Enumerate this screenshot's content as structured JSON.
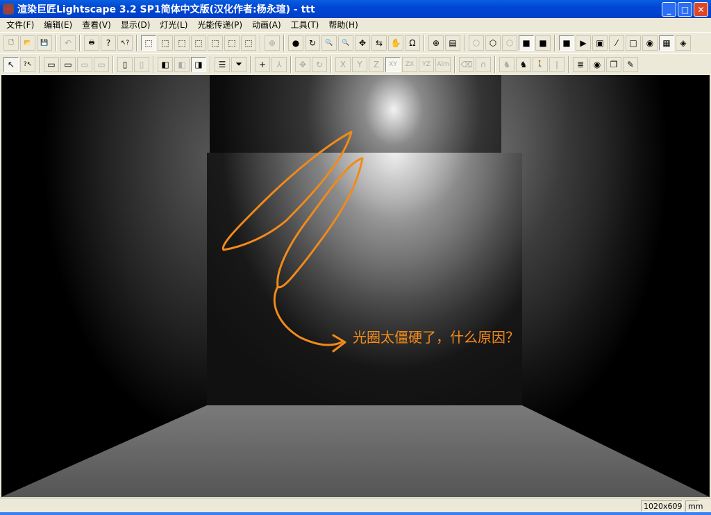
{
  "window": {
    "title": "渲染巨匠Lightscape 3.2 SP1简体中文版(汉化作者:杨永瑄) - ttt",
    "minimize": "_",
    "maximize": "□",
    "close": "✕"
  },
  "menu": [
    "文件(F)",
    "编辑(E)",
    "查看(V)",
    "显示(D)",
    "灯光(L)",
    "光能传递(P)",
    "动画(A)",
    "工具(T)",
    "帮助(H)"
  ],
  "toolbar1": [
    {
      "n": "new-file",
      "g": "🗋"
    },
    {
      "n": "open-folder",
      "g": "📂"
    },
    {
      "n": "save",
      "g": "💾"
    },
    "|",
    {
      "n": "undo",
      "g": "↶",
      "d": 1
    },
    "|",
    {
      "n": "print",
      "g": "🖶"
    },
    {
      "n": "help",
      "g": "?"
    },
    {
      "n": "context-help",
      "g": "↖?"
    },
    "|",
    {
      "n": "select-cube",
      "g": "⬚",
      "on": 1
    },
    {
      "n": "wireframe",
      "g": "⬚"
    },
    {
      "n": "shade-front",
      "g": "⬚"
    },
    {
      "n": "shade-top",
      "g": "⬚"
    },
    {
      "n": "shade-side",
      "g": "⬚"
    },
    {
      "n": "shade-back",
      "g": "⬚"
    },
    {
      "n": "shade-all",
      "g": "⬚"
    },
    "|",
    {
      "n": "zoom-extents",
      "g": "⊕",
      "d": 1
    },
    "|",
    {
      "n": "orbit",
      "g": "●"
    },
    {
      "n": "rotate-view",
      "g": "↻"
    },
    {
      "n": "zoom-in",
      "g": "🔍"
    },
    {
      "n": "zoom",
      "g": "🔍"
    },
    {
      "n": "pan",
      "g": "✥"
    },
    {
      "n": "dolly",
      "g": "⇆"
    },
    {
      "n": "walk",
      "g": "✋"
    },
    {
      "n": "roll",
      "g": "Ω"
    },
    "|",
    {
      "n": "zoom-window",
      "g": "⊕"
    },
    {
      "n": "camera-view",
      "g": "▤"
    },
    "|",
    {
      "n": "display-wire",
      "g": "⬡",
      "d": 1
    },
    {
      "n": "display-hidden",
      "g": "⬡"
    },
    {
      "n": "display-outline",
      "g": "⬡",
      "d": 1
    },
    {
      "n": "display-solid",
      "g": "■",
      "on": 1
    },
    {
      "n": "display-shaded",
      "g": "■"
    },
    "|",
    {
      "n": "texture",
      "g": "■",
      "on": 1
    },
    {
      "n": "mesh",
      "g": "▶"
    },
    {
      "n": "layers",
      "g": "▣"
    },
    {
      "n": "lines",
      "g": "⁄"
    },
    {
      "n": "light-color",
      "g": "□"
    },
    {
      "n": "globe",
      "g": "◉"
    },
    {
      "n": "background",
      "g": "▦",
      "on": 1
    },
    {
      "n": "render",
      "g": "◈"
    }
  ],
  "toolbar2": [
    {
      "n": "select",
      "g": "↖",
      "on": 1
    },
    {
      "n": "query",
      "g": "?↖"
    },
    "|",
    {
      "n": "select-window",
      "g": "▭"
    },
    {
      "n": "zoom-select",
      "g": "▭"
    },
    {
      "n": "deselect",
      "g": "▭",
      "d": 1
    },
    {
      "n": "deselect-window",
      "g": "▭",
      "d": 1
    },
    "|",
    {
      "n": "select-page",
      "g": "▯"
    },
    {
      "n": "page",
      "g": "▯",
      "d": 1
    },
    "|",
    {
      "n": "select-surface",
      "g": "◧"
    },
    {
      "n": "select-group",
      "g": "◧",
      "d": 1
    },
    {
      "n": "select-light",
      "g": "◨",
      "on": 1
    },
    "|",
    {
      "n": "list",
      "g": "☰"
    },
    {
      "n": "filter",
      "g": "⏷"
    },
    "|",
    {
      "n": "add-point",
      "g": "+"
    },
    {
      "n": "hierarchy",
      "g": "⅄",
      "d": 1
    },
    "|",
    {
      "n": "move",
      "g": "✥",
      "d": 1
    },
    {
      "n": "rotate",
      "g": "↻",
      "d": 1
    },
    "|",
    {
      "n": "axis-x",
      "g": "X",
      "d": 1
    },
    {
      "n": "axis-y",
      "g": "Y",
      "d": 1
    },
    {
      "n": "axis-z",
      "g": "Z",
      "d": 1
    },
    {
      "n": "plane-xy",
      "g": "XY",
      "d": 1,
      "on": 1
    },
    {
      "n": "plane-zx",
      "g": "ZX",
      "d": 1
    },
    {
      "n": "plane-yz",
      "g": "YZ",
      "d": 1
    },
    {
      "n": "aim",
      "g": "Alm",
      "d": 1
    },
    "|",
    {
      "n": "erase",
      "g": "⌫",
      "d": 1
    },
    {
      "n": "magnet",
      "g": "∩",
      "d": 1
    },
    "|",
    {
      "n": "crawl",
      "g": "♞",
      "d": 1
    },
    {
      "n": "crouch",
      "g": "♞"
    },
    {
      "n": "walk-man",
      "g": "🚶"
    },
    {
      "n": "stand",
      "g": "ǀ",
      "d": 1
    },
    "|",
    {
      "n": "layer-stack",
      "g": "≣"
    },
    {
      "n": "record",
      "g": "◉"
    },
    {
      "n": "copy-layer",
      "g": "❐"
    },
    {
      "n": "lamp",
      "g": "✎"
    }
  ],
  "annotation": "光圈太僵硬了，什么原因？",
  "status": {
    "resolution": "1020x609",
    "units": "mm"
  },
  "colors": {
    "annotation": "#f28a1a"
  }
}
